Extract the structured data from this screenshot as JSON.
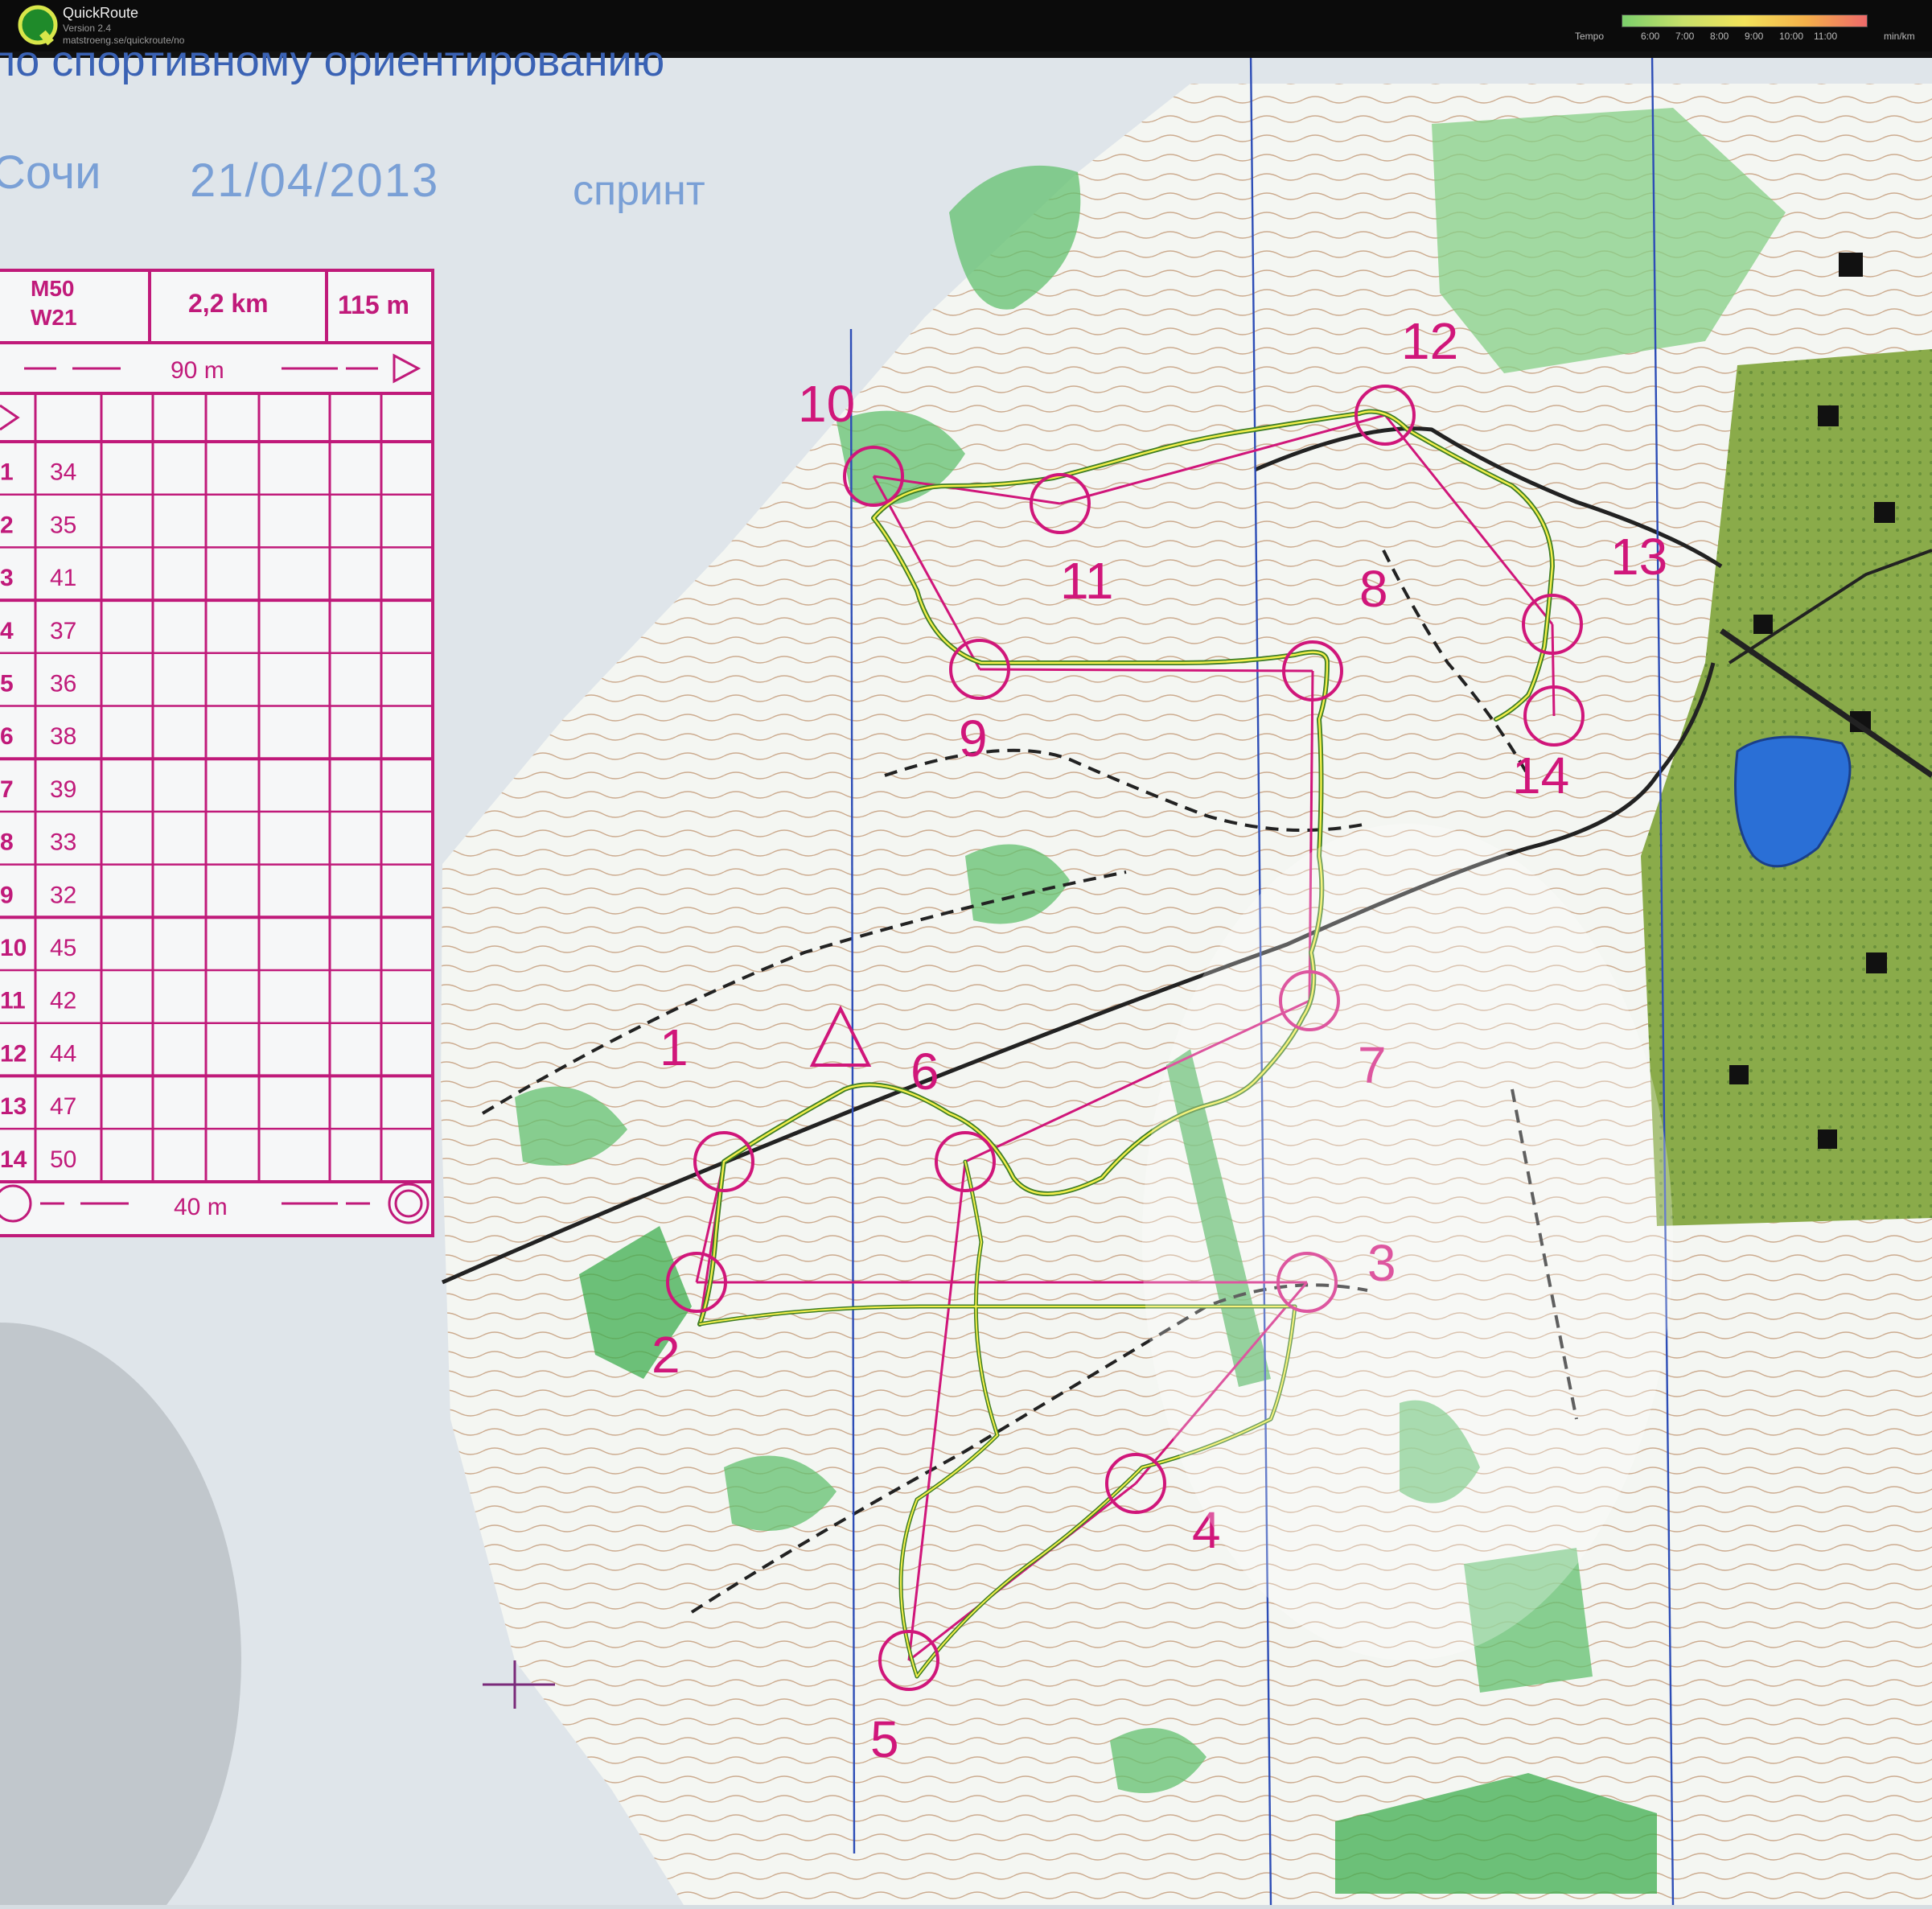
{
  "app": {
    "name": "QuickRoute",
    "version": "Version 2.4",
    "url": "matstroeng.se/quickroute/no"
  },
  "tempo": {
    "label": "Tempo",
    "ticks": [
      "6:00",
      "7:00",
      "8:00",
      "9:00",
      "10:00",
      "11:00"
    ],
    "unit": "min/km",
    "colors": [
      "#7ccf6b",
      "#c8e06a",
      "#f2e25a",
      "#f4b04a",
      "#ee6a6a"
    ]
  },
  "map": {
    "heading": "по спортивному ориентированию",
    "location": "Сочи",
    "date": "21/04/2013",
    "discipline": "спринт",
    "legend": {
      "classes": [
        "M50",
        "W21"
      ],
      "length": "2,2 km",
      "climb": "115 m",
      "start_distance": "90 m",
      "finish_distance": "40 m",
      "controls": [
        {
          "n": "1",
          "code": "34"
        },
        {
          "n": "2",
          "code": "35"
        },
        {
          "n": "3",
          "code": "41"
        },
        {
          "n": "4",
          "code": "37"
        },
        {
          "n": "5",
          "code": "36"
        },
        {
          "n": "6",
          "code": "38"
        },
        {
          "n": "7",
          "code": "39"
        },
        {
          "n": "8",
          "code": "33"
        },
        {
          "n": "9",
          "code": "32"
        },
        {
          "n": "10",
          "code": "45"
        },
        {
          "n": "11",
          "code": "42"
        },
        {
          "n": "12",
          "code": "44"
        },
        {
          "n": "13",
          "code": "47"
        },
        {
          "n": "14",
          "code": "50"
        }
      ]
    },
    "control_labels": [
      "1",
      "2",
      "3",
      "4",
      "5",
      "6",
      "7",
      "8",
      "9",
      "10",
      "11",
      "12",
      "13",
      "14"
    ],
    "colors": {
      "course": "#d0167a",
      "contour": "#a46b3f",
      "forest": "#5fbf6e",
      "water": "#2a6fd6",
      "north_line": "#2d4db6"
    }
  }
}
